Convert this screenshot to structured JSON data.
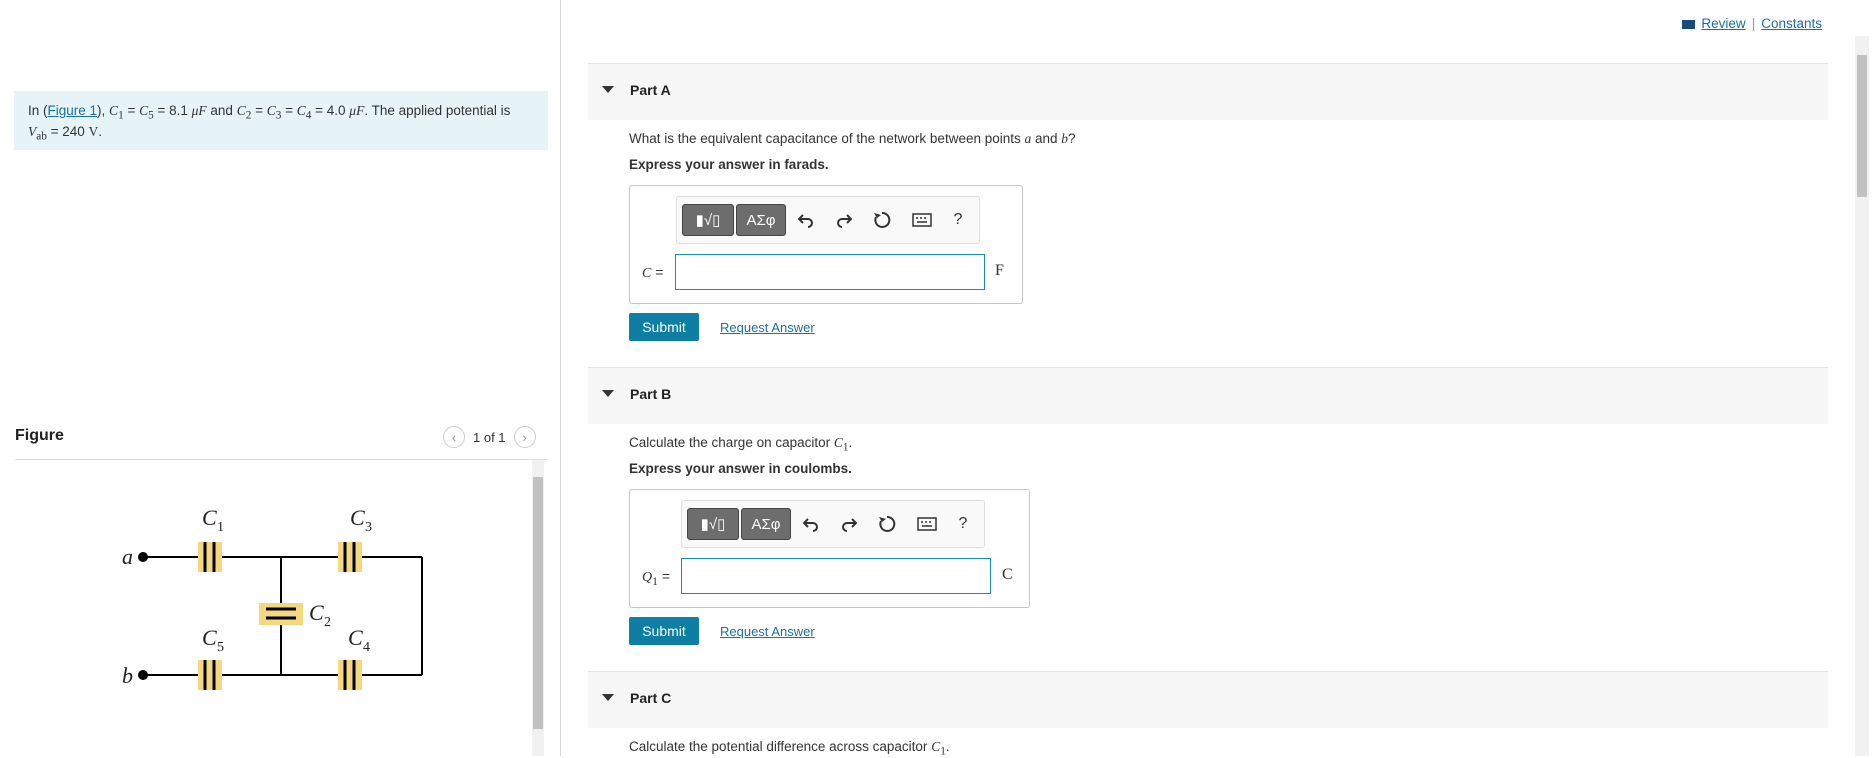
{
  "header": {
    "review_label": "Review",
    "separator": "|",
    "constants_label": "Constants"
  },
  "problem": {
    "prefix": "In (",
    "figure_link": "Figure 1",
    "after_link": "), ",
    "c1": "C",
    "c1_sub": "1",
    "eq1": " = ",
    "c5": "C",
    "c5_sub": "5",
    "val1": " = 8.1 ",
    "unit1": "μF",
    "and": " and ",
    "c2": "C",
    "c2_sub": "2",
    "c3": "C",
    "c3_sub": "3",
    "c4": "C",
    "c4_sub": "4",
    "val2": " = 4.0 ",
    "unit2": "μF",
    "applied": ". The applied potential is",
    "vab": "V",
    "vab_sub": "ab",
    "vab_val": " = 240 ",
    "vab_unit": "V",
    "end": "."
  },
  "figure": {
    "title": "Figure",
    "pager": "1 of 1",
    "labels": {
      "c1": "C",
      "c1s": "1",
      "c2": "C",
      "c2s": "2",
      "c3": "C",
      "c3s": "3",
      "c4": "C",
      "c4s": "4",
      "c5": "C",
      "c5s": "5",
      "a": "a",
      "b": "b"
    }
  },
  "toolbar": {
    "templates_label": "▮√▯",
    "greek_label": "ΑΣφ",
    "help_label": "?"
  },
  "partA": {
    "label": "Part A",
    "question_pre": "What is the equivalent capacitance of the network between points ",
    "point_a": "a",
    "question_mid": " and ",
    "point_b": "b",
    "question_end": "?",
    "express": "Express your answer in farads.",
    "var": "C",
    "var_eq": " =",
    "input_value": "",
    "unit": "F",
    "submit": "Submit",
    "request": "Request Answer"
  },
  "partB": {
    "label": "Part B",
    "question_pre": "Calculate the charge on capacitor ",
    "cap": "C",
    "cap_sub": "1",
    "question_end": ".",
    "express": "Express your answer in coulombs.",
    "var": "Q",
    "var_sub": "1",
    "var_eq": " =",
    "input_value": "",
    "unit": "C",
    "submit": "Submit",
    "request": "Request Answer"
  },
  "partC": {
    "label": "Part C",
    "question_pre": "Calculate the potential difference across capacitor ",
    "cap": "C",
    "cap_sub": "1",
    "question_end": "."
  }
}
